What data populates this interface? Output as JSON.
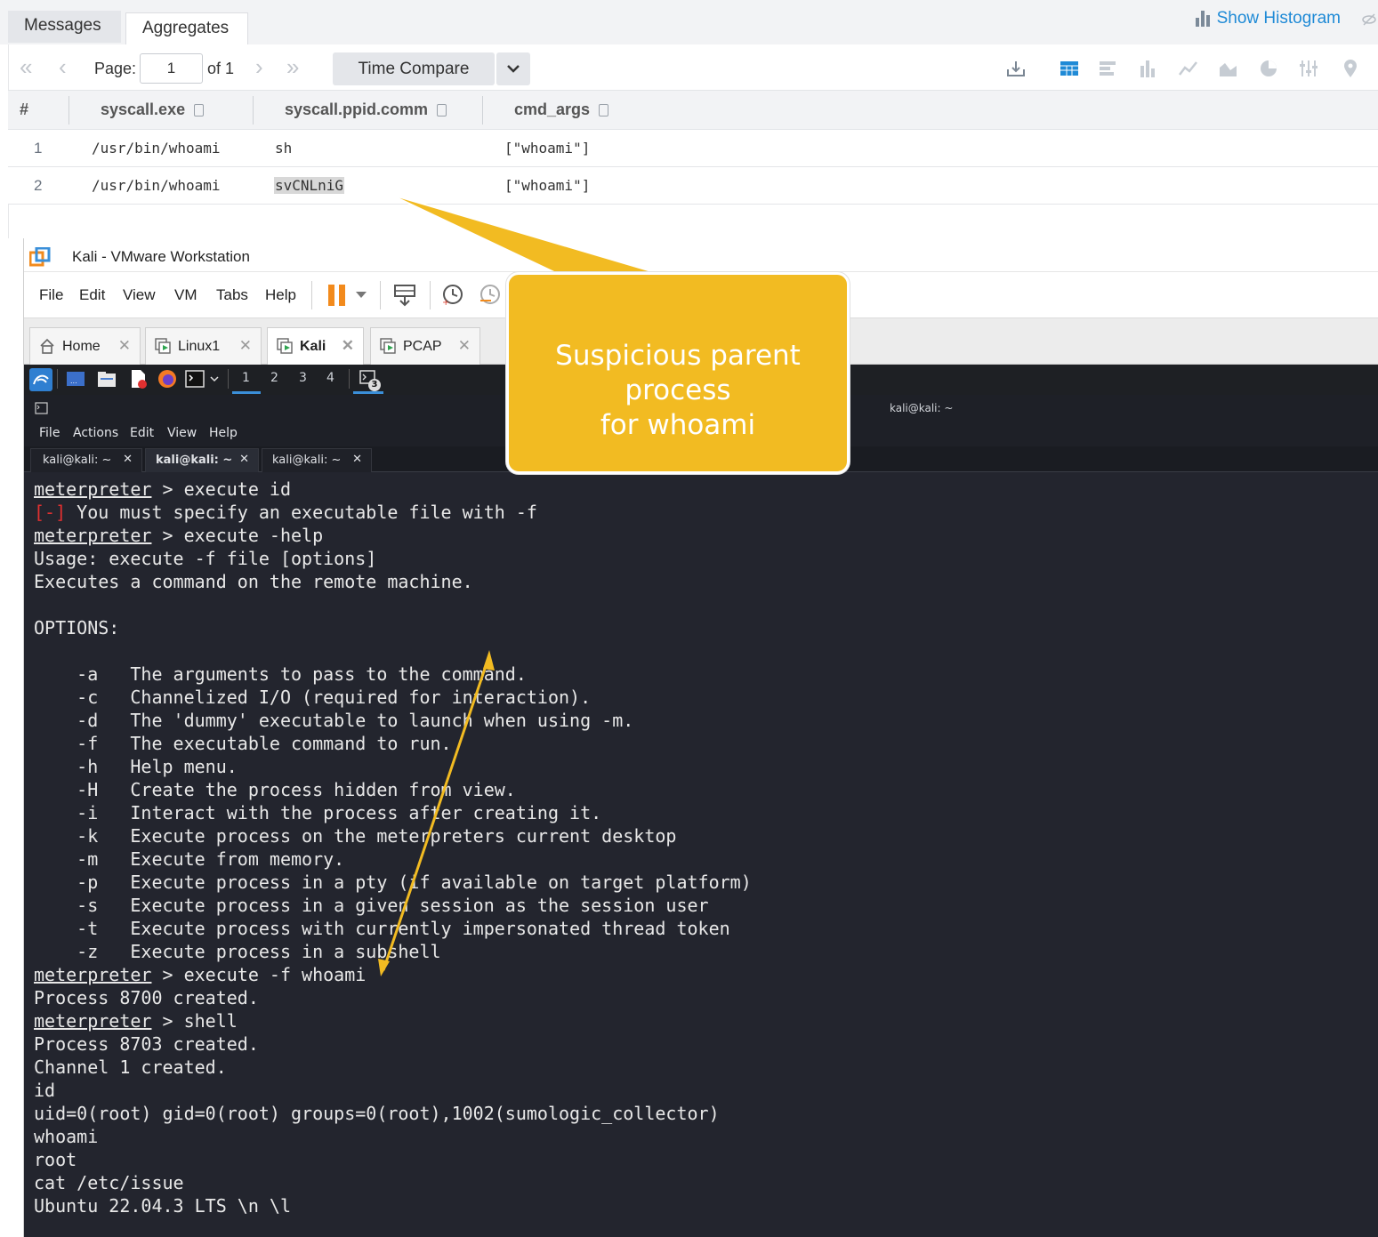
{
  "sumo": {
    "tabs": [
      "Messages",
      "Aggregates"
    ],
    "show_histogram": "Show Histogram",
    "page_label": "Page:",
    "page_value": "1",
    "of_label": "of 1",
    "time_compare": "Time Compare",
    "columns": [
      "#",
      "syscall.exe",
      "syscall.ppid.comm",
      "cmd_args"
    ],
    "rows": [
      {
        "num": "1",
        "exe": "/usr/bin/whoami",
        "comm": "sh",
        "args": "[\"whoami\"]"
      },
      {
        "num": "2",
        "exe": "/usr/bin/whoami",
        "comm": "svCNLniG",
        "args": "[\"whoami\"]"
      }
    ],
    "toolbar_icons": [
      "download-icon",
      "table-icon",
      "bar-horizontal-icon",
      "bar-vertical-icon",
      "line-chart-icon",
      "area-chart-icon",
      "pie-chart-icon",
      "settings-sliders-icon",
      "map-pin-icon"
    ]
  },
  "vmware": {
    "title": "Kali - VMware Workstation",
    "menu": [
      "File",
      "Edit",
      "View",
      "VM",
      "Tabs",
      "Help"
    ],
    "tabs": [
      "Home",
      "Linux1",
      "Kali",
      "PCAP"
    ],
    "active_tab": "Kali"
  },
  "kali": {
    "workspaces": [
      "1",
      "2",
      "3",
      "4"
    ],
    "notification_count": "3",
    "terminal_title": "kali@kali: ~",
    "terminal_menu": [
      "File",
      "Actions",
      "Edit",
      "View",
      "Help"
    ],
    "terminal_tabs": [
      "kali@kali: ~",
      "kali@kali: ~",
      "kali@kali: ~"
    ],
    "prompt": "meterpreter",
    "lines": [
      {
        "prompt": "meterpreter",
        "text": " > execute id"
      },
      {
        "err": "[-]",
        "text": " You must specify an executable file with -f"
      },
      {
        "prompt": "meterpreter",
        "text": " > execute -help"
      },
      {
        "text": "Usage: execute -f file [options]"
      },
      {
        "text": "Executes a command on the remote machine."
      },
      {
        "text": ""
      },
      {
        "text": "OPTIONS:"
      },
      {
        "text": ""
      },
      {
        "text": "    -a   The arguments to pass to the command."
      },
      {
        "text": "    -c   Channelized I/O (required for interaction)."
      },
      {
        "text": "    -d   The 'dummy' executable to launch when using -m."
      },
      {
        "text": "    -f   The executable command to run."
      },
      {
        "text": "    -h   Help menu."
      },
      {
        "text": "    -H   Create the process hidden from view."
      },
      {
        "text": "    -i   Interact with the process after creating it."
      },
      {
        "text": "    -k   Execute process on the meterpreters current desktop"
      },
      {
        "text": "    -m   Execute from memory."
      },
      {
        "text": "    -p   Execute process in a pty (if available on target platform)"
      },
      {
        "text": "    -s   Execute process in a given session as the session user"
      },
      {
        "text": "    -t   Execute process with currently impersonated thread token"
      },
      {
        "text": "    -z   Execute process in a subshell"
      },
      {
        "prompt": "meterpreter",
        "text": " > execute -f whoami"
      },
      {
        "text": "Process 8700 created."
      },
      {
        "prompt": "meterpreter",
        "text": " > shell"
      },
      {
        "text": "Process 8703 created."
      },
      {
        "text": "Channel 1 created."
      },
      {
        "text": "id"
      },
      {
        "text": "uid=0(root) gid=0(root) groups=0(root),1002(sumologic_collector)"
      },
      {
        "text": "whoami"
      },
      {
        "text": "root"
      },
      {
        "text": "cat /etc/issue"
      },
      {
        "text": "Ubuntu 22.04.3 LTS \\n \\l"
      }
    ]
  },
  "callout": {
    "text_line1": "Suspicious parent process",
    "text_line2": "for whoami"
  },
  "colors": {
    "callout_fill": "#f2bb22",
    "sumo_link": "#1f8ad6",
    "terminal_bg": "#23252e",
    "error_red": "#e03030",
    "arrow": "#f2bb22"
  }
}
